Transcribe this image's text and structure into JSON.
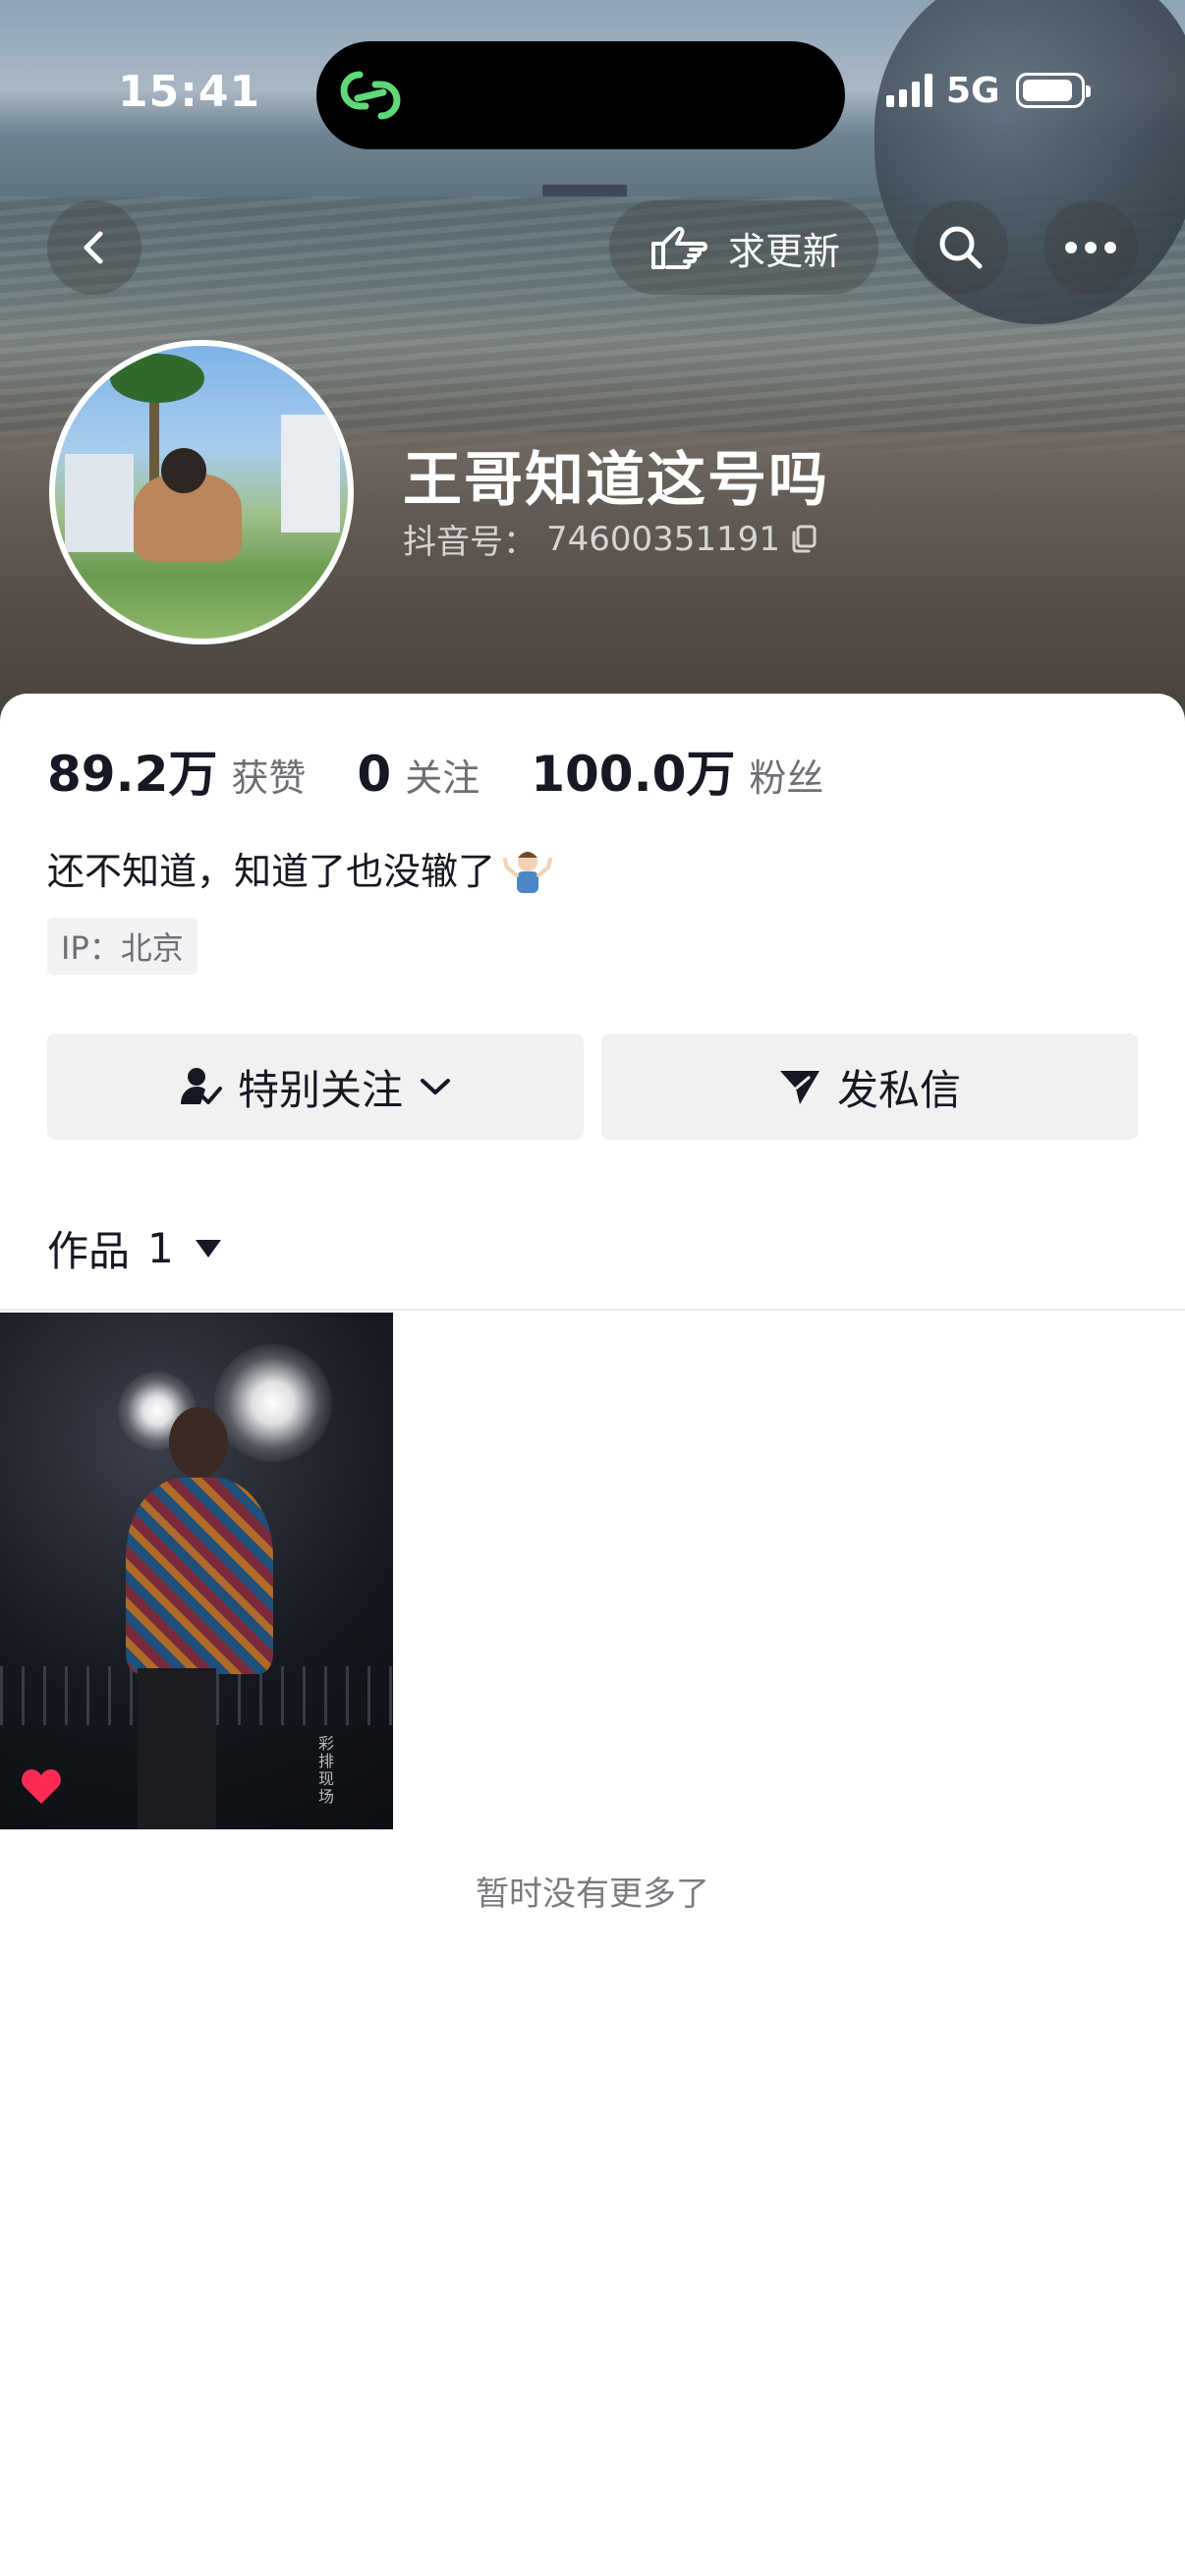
{
  "status_bar": {
    "time": "15:41",
    "network": "5G",
    "battery_level": 0.9,
    "icons": [
      "signal-icon",
      "battery-icon",
      "live-activity-icon"
    ]
  },
  "nav": {
    "back_icon": "chevron-left-icon",
    "request_update_label": "求更新",
    "request_update_icon": "pointing-hand-icon",
    "search_icon": "search-icon",
    "more_icon": "more-icon"
  },
  "profile": {
    "nickname": "王哥知道这号吗",
    "douyin_id_label": "抖音号：",
    "douyin_id": "74600351191",
    "copy_icon": "copy-icon"
  },
  "stats": [
    {
      "value": "89.2万",
      "label": "获赞"
    },
    {
      "value": "0",
      "label": "关注"
    },
    {
      "value": "100.0万",
      "label": "粉丝"
    }
  ],
  "bio": {
    "text": "还不知道，知道了也没辙了",
    "emoji_icon": "person-shrugging-icon"
  },
  "ip_tag": "IP：北京",
  "actions": {
    "follow_label": "特别关注",
    "follow_icon": "user-check-icon",
    "message_label": "发私信",
    "message_icon": "send-icon"
  },
  "works_tab": {
    "label": "作品",
    "count": "1"
  },
  "videos": [
    {
      "liked": true,
      "overlay_text": "彩排现场"
    }
  ],
  "footer_text": "暂时没有更多了",
  "colors": {
    "text_primary": "#161823",
    "text_secondary": "#6e6f75",
    "button_bg": "#f1f1f2",
    "like_red": "#fe2c55",
    "island_green": "#5ed97a"
  }
}
